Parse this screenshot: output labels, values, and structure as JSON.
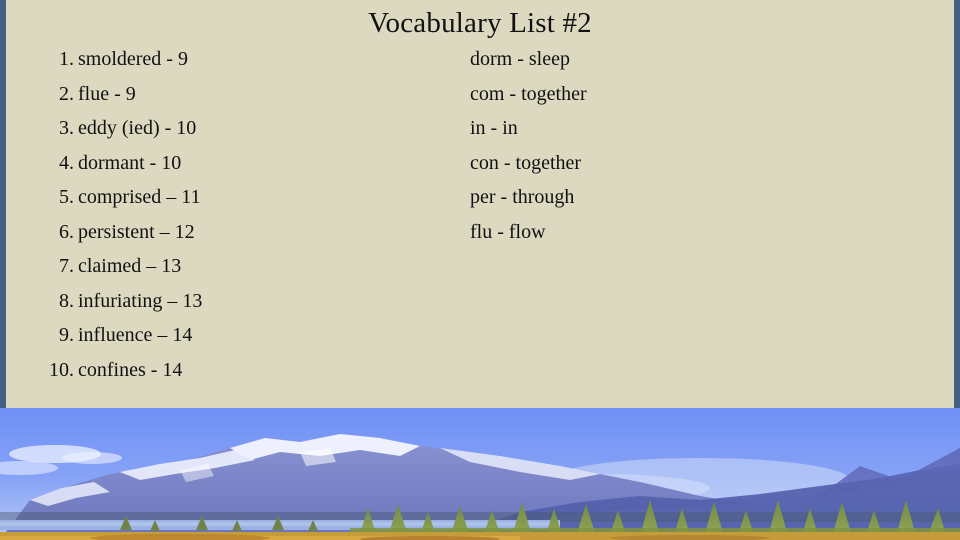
{
  "slide": {
    "title": "Vocabulary List #2",
    "background_color": "#dcd9c0",
    "rail_color": "#43617f",
    "text_color": "#111111"
  },
  "vocabulary": {
    "items": [
      {
        "number": "1.",
        "term": "smoldered - 9"
      },
      {
        "number": "2.",
        "term": "flue - 9"
      },
      {
        "number": "3.",
        "term": "eddy (ied) - 10"
      },
      {
        "number": "4.",
        "term": "dormant - 10"
      },
      {
        "number": "5.",
        "term": "comprised – 11"
      },
      {
        "number": "6.",
        "term": "persistent – 12"
      },
      {
        "number": "7.",
        "term": "claimed – 13"
      },
      {
        "number": "8.",
        "term": "infuriating – 13"
      },
      {
        "number": "9.",
        "term": "influence – 14"
      },
      {
        "number": "10.",
        "term": "confines - 14"
      }
    ]
  },
  "roots": {
    "items": [
      {
        "text": "dorm - sleep"
      },
      {
        "text": "com - together"
      },
      {
        "text": "in - in"
      },
      {
        "text": "con - together"
      },
      {
        "text": "per - through"
      },
      {
        "text": "flu - flow"
      }
    ]
  },
  "photo": {
    "caption": "snow-capped mountain range with conifer forest and lake",
    "sky_color": "#7c9bf5",
    "mountain_color": "#6e77c4",
    "snow_color": "#f2f4ff",
    "forest_color": "#7f9440",
    "lake_color": "#8ea8dd",
    "grass_color": "#c79a3a"
  }
}
